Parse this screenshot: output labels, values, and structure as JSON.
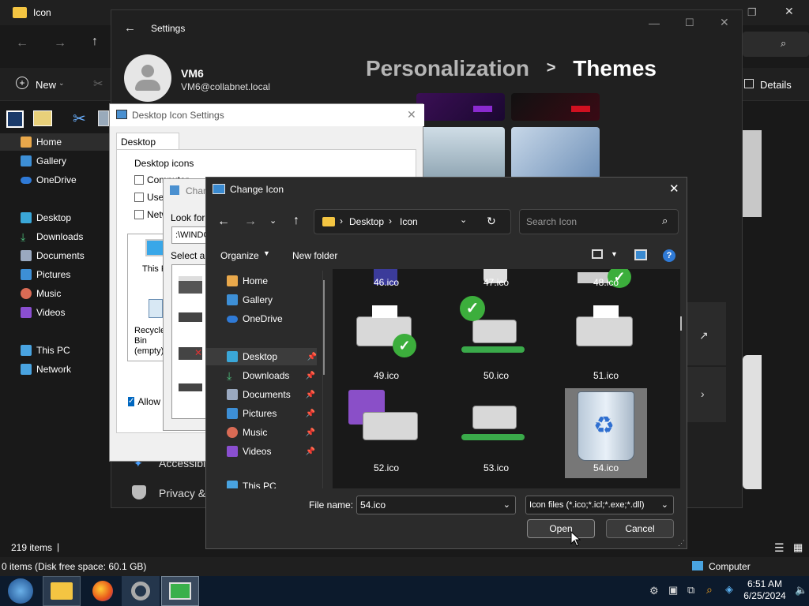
{
  "explorer": {
    "title": "Icon",
    "cmd": {
      "new_label": "New",
      "details_label": "Details"
    },
    "side": [
      "Home",
      "Gallery",
      "OneDrive",
      "Desktop",
      "Downloads",
      "Documents",
      "Pictures",
      "Music",
      "Videos",
      "This PC",
      "Network"
    ],
    "status": {
      "items": "219 items",
      "bottom_left": "0 items (Disk free space: 60.1 GB)",
      "bottom_right": "Computer"
    }
  },
  "settings": {
    "title": "Settings",
    "user_name": "VM6",
    "user_email": "VM6@collabnet.local",
    "breadcrumb_parent": "Personalization",
    "breadcrumb_sep": ">",
    "breadcrumb_current": "Themes",
    "side_items": [
      "Accessibility",
      "Privacy & security"
    ]
  },
  "desktop_icon_settings": {
    "title": "Desktop Icon Settings",
    "tab": "Desktop Icons",
    "group": "Desktop icons",
    "checks": [
      "Computer",
      "User's Files",
      "Network"
    ],
    "check2": "Recycle Bin",
    "icons": [
      "This PC",
      "Recycle Bin (empty)"
    ],
    "allow": "Allow themes to change desktop icons"
  },
  "change_icon_bg": {
    "title": "Change Icon",
    "look_for": "Look for icons in this file:",
    "path": ":\\WINDOWS",
    "select": "Select an icon from the list below:"
  },
  "dialog": {
    "title": "Change Icon",
    "address": [
      "Desktop",
      "Icon"
    ],
    "search_placeholder": "Search Icon",
    "organize": "Organize",
    "new_folder": "New folder",
    "tree": [
      {
        "label": "Home",
        "pin": false
      },
      {
        "label": "Gallery",
        "pin": false
      },
      {
        "label": "OneDrive",
        "pin": false
      },
      {
        "label": "Desktop",
        "pin": true
      },
      {
        "label": "Downloads",
        "pin": true
      },
      {
        "label": "Documents",
        "pin": true
      },
      {
        "label": "Pictures",
        "pin": true
      },
      {
        "label": "Music",
        "pin": true
      },
      {
        "label": "Videos",
        "pin": true
      },
      {
        "label": "This PC",
        "pin": false
      }
    ],
    "files": [
      "46.ico",
      "47.ico",
      "48.ico",
      "49.ico",
      "50.ico",
      "51.ico",
      "52.ico",
      "53.ico",
      "54.ico"
    ],
    "file_name_label": "File name:",
    "file_name_value": "54.ico",
    "file_type": "Icon files (*.ico;*.icl;*.exe;*.dll)",
    "open": "Open",
    "cancel": "Cancel"
  },
  "taskbar": {
    "time": "6:51 AM",
    "date": "6/25/2024"
  },
  "colors": {
    "accent": "#0067c0",
    "selection": "#777777",
    "dialog_bg": "#2b2b2b"
  }
}
